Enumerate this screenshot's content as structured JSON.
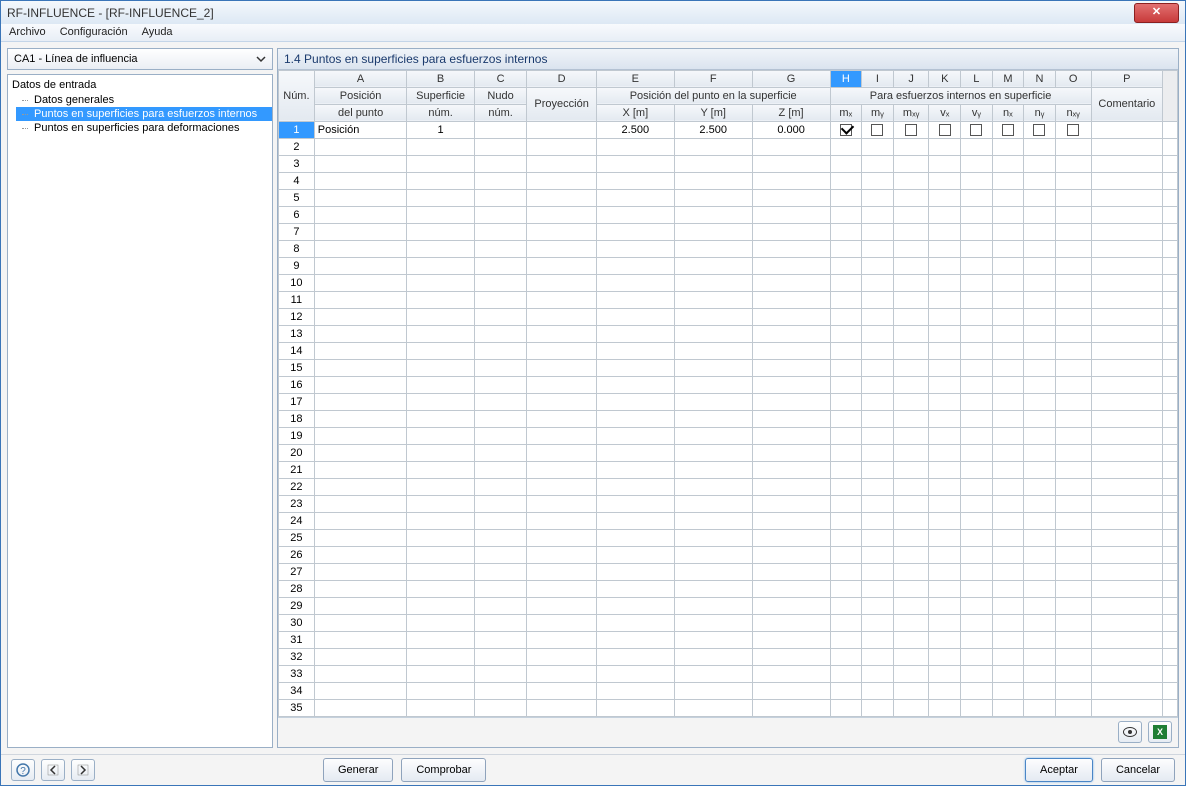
{
  "window": {
    "title": "RF-INFLUENCE - [RF-INFLUENCE_2]"
  },
  "menubar": {
    "archivo": "Archivo",
    "configuracion": "Configuración",
    "ayuda": "Ayuda"
  },
  "combo": {
    "value": "CA1 - Línea de influencia"
  },
  "tree": {
    "root": "Datos de entrada",
    "items": {
      "0": "Datos generales",
      "1": "Puntos en superficies para esfuerzos internos",
      "2": "Puntos en superficies para deformaciones"
    }
  },
  "panel": {
    "title": "1.4 Puntos en superficies para esfuerzos internos"
  },
  "cols": {
    "letters": {
      "0": "A",
      "1": "B",
      "2": "C",
      "3": "D",
      "4": "E",
      "5": "F",
      "6": "G",
      "7": "H",
      "8": "I",
      "9": "J",
      "10": "K",
      "11": "L",
      "12": "M",
      "13": "N",
      "14": "O",
      "15": "P"
    },
    "num": "Núm.",
    "posicion_top": "Posición",
    "posicion_bot": "del punto",
    "superficie_top": "Superficie",
    "superficie_bot": "núm.",
    "nudo_top": "Nudo",
    "nudo_bot": "núm.",
    "proyeccion": "Proyección",
    "grp_pos": "Posición del punto en la superficie",
    "x": "X [m]",
    "y": "Y [m]",
    "z": "Z [m]",
    "grp_esf": "Para esfuerzos internos en superficie",
    "mx": "mₓ",
    "my": "mᵧ",
    "mxy": "mₓᵧ",
    "vx": "vₓ",
    "vy": "vᵧ",
    "nx": "nₓ",
    "ny": "nᵧ",
    "nxy": "nₓᵧ",
    "comentario": "Comentario"
  },
  "row1": {
    "posicion": "Posición",
    "superficie": "1",
    "x": "2.500",
    "y": "2.500",
    "z": "0.000"
  },
  "buttons": {
    "generar": "Generar",
    "comprobar": "Comprobar",
    "aceptar": "Aceptar",
    "cancelar": "Cancelar"
  },
  "icons": {
    "xls": "X"
  }
}
